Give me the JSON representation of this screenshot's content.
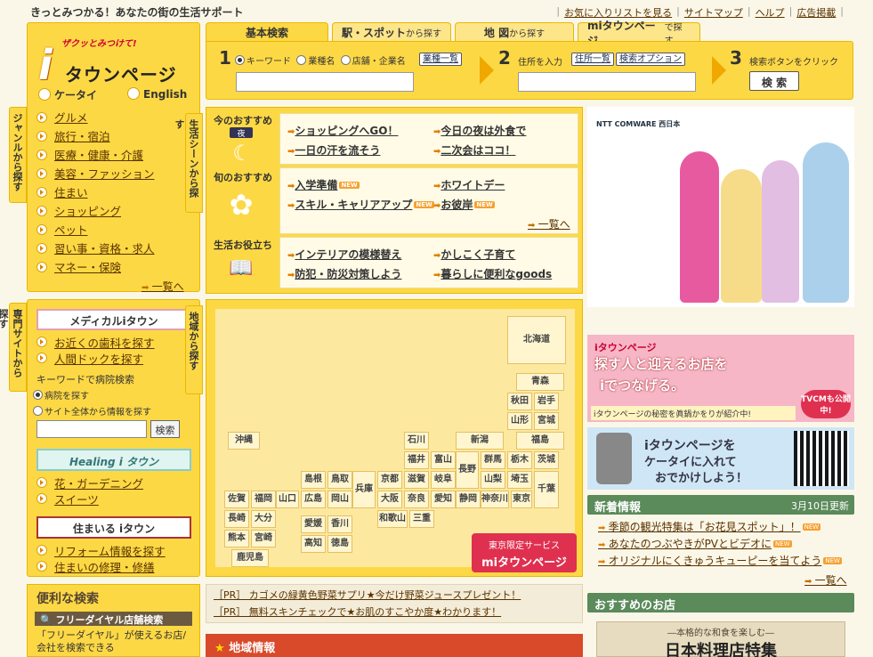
{
  "header": {
    "tagline": "きっとみつかる！あなたの街の生活サポート",
    "links": [
      "お気に入りリストを見る",
      "サイトマップ",
      "ヘルプ",
      "広告掲載"
    ]
  },
  "logo": {
    "catch": "ザクッとみつけて!",
    "i": "i",
    "name": "タウンページ"
  },
  "mobile": {
    "keitai": "ケータイ",
    "english": "English"
  },
  "genre": {
    "tab": "ジャンルから探す",
    "items": [
      "グルメ",
      "旅行・宿泊",
      "医療・健康・介護",
      "美容・ファッション",
      "住まい",
      "ショッピング",
      "ペット",
      "習い事・資格・求人",
      "マネー・保険"
    ],
    "more": "一覧へ"
  },
  "senmon": {
    "tab": "専門サイトから探す",
    "medical_banner": "メディカルiタウン",
    "medical_links": [
      "お近くの歯科を探す",
      "人間ドックを探す"
    ],
    "keyword_label": "キーワードで病院検索",
    "radio1": "病院を探す",
    "radio2": "サイト全体から情報を探す",
    "search_btn": "検索",
    "healing_banner": "Healing i タウン",
    "healing_links": [
      "花・ガーデニング",
      "スイーツ"
    ],
    "sumairu_banner": "住まいる iタウン",
    "sumai_links": [
      "リフォーム情報を探す",
      "住まいの修理・修繕"
    ]
  },
  "search": {
    "tabs": [
      {
        "main": "基本検索",
        "sub": ""
      },
      {
        "main": "駅・スポット",
        "sub": "から探す"
      },
      {
        "main": "地 図",
        "sub": "から探す"
      },
      {
        "main": "miタウンページ",
        "sub": "で探す"
      }
    ],
    "step1": "1",
    "radio_keyword": "キーワード",
    "radio_gyoshu": "業種名",
    "radio_tenpo": "店舗・企業名",
    "gyoshu_list_btn": "業種一覧",
    "step2": "2",
    "address_label": "住所を入力",
    "address_list_btn": "住所一覧",
    "option_btn": "検索オプション",
    "step3": "3",
    "step3_label": "検索ボタンをクリック",
    "search_btn": "検 索"
  },
  "scene": {
    "tab": "生活シーンから探す",
    "today_label": "今のおすすめ",
    "today_badge": "夜",
    "shun_label": "旬のおすすめ",
    "yakudachi_label": "生活お役立ち",
    "today_items": [
      "ショッピングへGO！",
      "今日の夜は外食で",
      "一日の汗を流そう",
      "二次会はココ！"
    ],
    "shun_items": [
      "入学準備",
      "ホワイトデー",
      "スキル・キャリアアップ",
      "お彼岸"
    ],
    "new_label": "NEW",
    "shun_more": "一覧へ",
    "yakudachi_items": [
      "インテリアの模様替え",
      "かしこく子育て",
      "防犯・防災対策しよう",
      "暮らしに便利なgoods"
    ]
  },
  "map": {
    "tab": "地域から探す",
    "prefs": [
      "北海道",
      "青森",
      "秋田",
      "岩手",
      "山形",
      "宮城",
      "新潟",
      "福島",
      "石川",
      "群馬",
      "栃木",
      "茨城",
      "福井",
      "富山",
      "長野",
      "山梨",
      "埼玉",
      "千葉",
      "滋賀",
      "岐阜",
      "島根",
      "鳥取",
      "京都",
      "兵庫",
      "奈良",
      "愛知",
      "静岡",
      "神奈川",
      "東京",
      "大阪",
      "和歌山",
      "三重",
      "山口",
      "広島",
      "岡山",
      "愛媛",
      "香川",
      "高知",
      "徳島",
      "佐賀",
      "福岡",
      "長崎",
      "大分",
      "熊本",
      "宮崎",
      "鹿児島",
      "沖縄"
    ],
    "tokyo_service": "東京限定サービス",
    "tokyo_name": "miタウンページ"
  },
  "ntt": {
    "logo": "NTT COMWARE 西日本"
  },
  "banner1": {
    "line1": "iタウンページ",
    "line2": "探す人と迎えるお店を",
    "line3": "iでつなげる。",
    "line4": "iタウンページの秘密を眞鍋かをりが紹介中!",
    "badge": "TVCMも公開中!"
  },
  "banner2": {
    "line1": "iタウンページを",
    "line2": "ケータイに入れて",
    "line3": "おでかけしよう！"
  },
  "news": {
    "title": "新着情報",
    "date": "3月10日更新",
    "items": [
      "季節の観光特集は「お花見スポット」！",
      "あなたのつぶやきがPVとビデオに",
      "オリジナルにくきゅうキューピーを当てよう"
    ],
    "more": "一覧へ"
  },
  "convenient": {
    "title": "便利な検索",
    "bar": "フリーダイヤル店舗検索",
    "desc": "「フリーダイヤル」が使えるお店/会社を検索できる"
  },
  "pr": [
    "［PR］ カゴメの緑黄色野菜サプリ★今だけ野菜ジュースプレゼント！",
    "［PR］ 無料スキンチェックで★お肌のすこやか度★わかります！"
  ],
  "chiiki": "地域情報",
  "recommend": {
    "title": "おすすめのお店",
    "banner_top": "―本格的な和食を楽しむ―",
    "banner_main": "日本料理店特集"
  },
  "colors": {
    "yellow": "#fdd845",
    "border": "#e8b800",
    "green": "#5b8a5b",
    "red": "#d84a2a"
  }
}
